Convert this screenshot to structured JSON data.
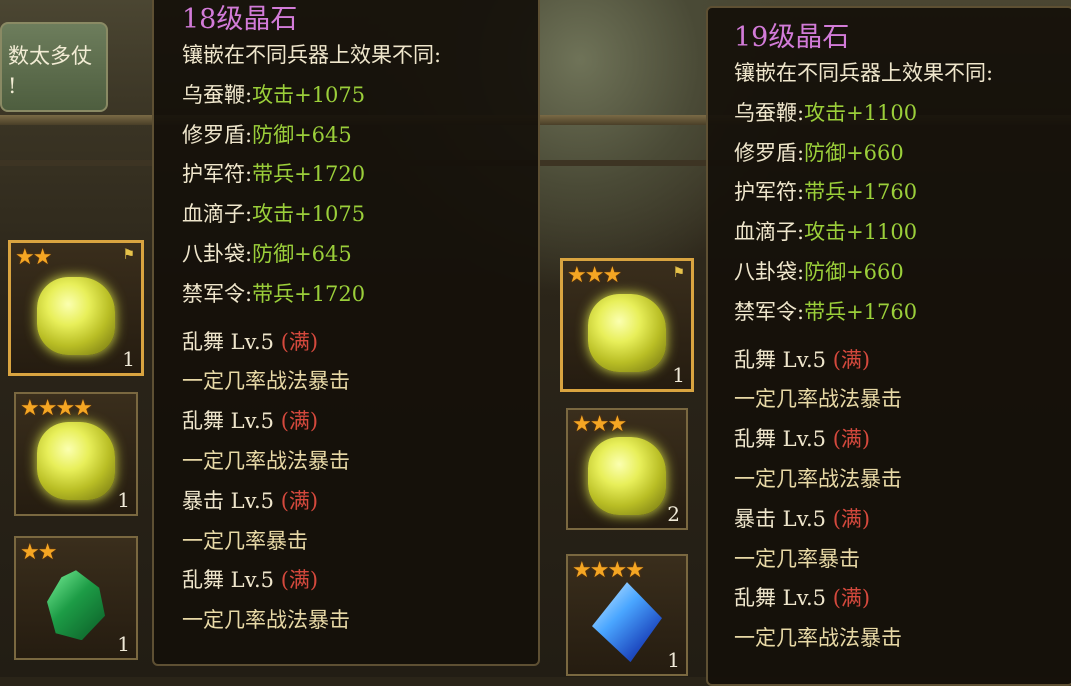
{
  "quest": {
    "line1": "数太多仗",
    "line2": "!"
  },
  "colors": {
    "title": "#d27bd8",
    "bonus": "#9bcf3a",
    "max": "#d5493d",
    "text": "#efe6cc",
    "star": "#f5a623"
  },
  "left_inventory": [
    {
      "icon": "yellow-crystal-icon",
      "stars": "★★",
      "count": "1",
      "selected": true
    },
    {
      "icon": "yellow-crystal-icon",
      "stars": "★★★★",
      "count": "1"
    },
    {
      "icon": "green-crystal-icon",
      "stars": "★★",
      "count": "1"
    }
  ],
  "right_inventory": [
    {
      "icon": "yellow-crystal-icon",
      "stars": "★★★",
      "count": "1",
      "selected": true
    },
    {
      "icon": "yellow-crystal-icon",
      "stars": "★★★",
      "count": "2"
    },
    {
      "icon": "blue-crystal-icon",
      "stars": "★★★★",
      "count": "1"
    }
  ],
  "tooltip_left": {
    "title": "18级晶石",
    "subtitle": "镶嵌在不同兵器上效果不同:",
    "bonuses": [
      {
        "weapon": "乌蚕鞭:",
        "effect": "攻击+1075"
      },
      {
        "weapon": "修罗盾:",
        "effect": "防御+645"
      },
      {
        "weapon": "护军符:",
        "effect": "带兵+1720"
      },
      {
        "weapon": "血滴子:",
        "effect": "攻击+1075"
      },
      {
        "weapon": "八卦袋:",
        "effect": "防御+645"
      },
      {
        "weapon": "禁军令:",
        "effect": "带兵+1720"
      }
    ],
    "skills": [
      {
        "name": "乱舞 Lv.5",
        "max": "(满)",
        "desc": "一定几率战法暴击"
      },
      {
        "name": "乱舞 Lv.5",
        "max": "(满)",
        "desc": "一定几率战法暴击"
      },
      {
        "name": "暴击 Lv.5",
        "max": "(满)",
        "desc": "一定几率暴击"
      },
      {
        "name": "乱舞 Lv.5",
        "max": "(满)",
        "desc": "一定几率战法暴击"
      }
    ]
  },
  "tooltip_right": {
    "title": "19级晶石",
    "subtitle": "镶嵌在不同兵器上效果不同:",
    "bonuses": [
      {
        "weapon": "乌蚕鞭:",
        "effect": "攻击+1100"
      },
      {
        "weapon": "修罗盾:",
        "effect": "防御+660"
      },
      {
        "weapon": "护军符:",
        "effect": "带兵+1760"
      },
      {
        "weapon": "血滴子:",
        "effect": "攻击+1100"
      },
      {
        "weapon": "八卦袋:",
        "effect": "防御+660"
      },
      {
        "weapon": "禁军令:",
        "effect": "带兵+1760"
      }
    ],
    "skills": [
      {
        "name": "乱舞 Lv.5",
        "max": "(满)",
        "desc": "一定几率战法暴击"
      },
      {
        "name": "乱舞 Lv.5",
        "max": "(满)",
        "desc": "一定几率战法暴击"
      },
      {
        "name": "暴击 Lv.5",
        "max": "(满)",
        "desc": "一定几率暴击"
      },
      {
        "name": "乱舞 Lv.5",
        "max": "(满)",
        "desc": "一定几率战法暴击"
      }
    ]
  }
}
